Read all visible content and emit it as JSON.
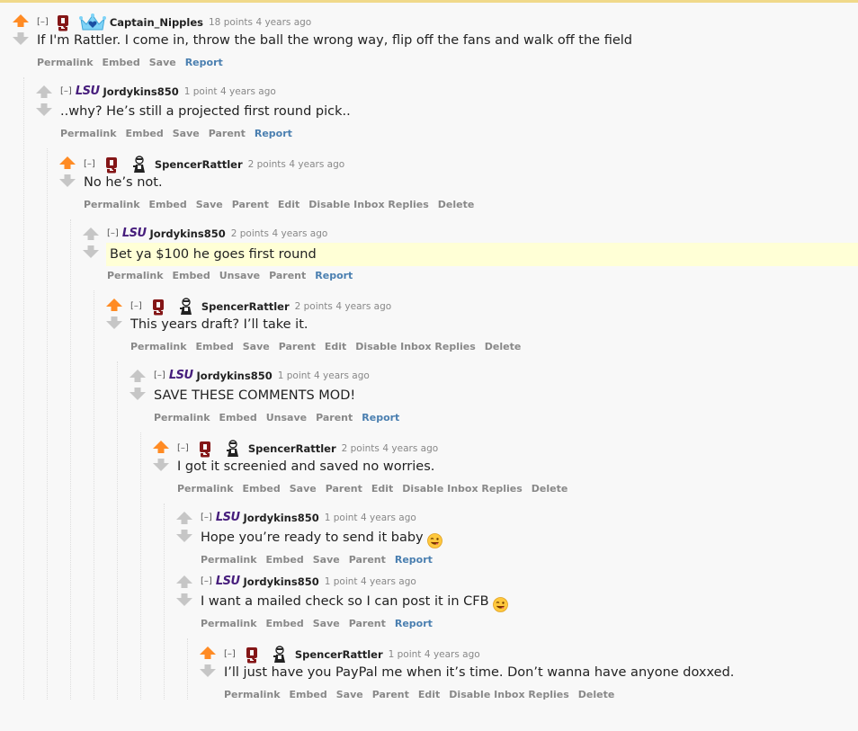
{
  "comments": [
    {
      "id": "c0",
      "depth": 0,
      "upvoted": true,
      "flair": "ou-crown",
      "expand": "[–]",
      "author": "Captain_Nipples",
      "score": "18 points",
      "time": "4 years ago",
      "body": "If I'm Rattler. I come in, throw the ball the wrong way, flip off the fans and walk off the field",
      "buttons": [
        "Permalink",
        "Embed",
        "Save",
        "Report"
      ]
    },
    {
      "id": "c1",
      "depth": 1,
      "upvoted": false,
      "flair": "lsu",
      "expand": "[–]",
      "author": "Jordykins850",
      "score": "1 point",
      "time": "4 years ago",
      "body": "..why? He’s still a projected first round pick..",
      "buttons": [
        "Permalink",
        "Embed",
        "Save",
        "Parent",
        "Report"
      ]
    },
    {
      "id": "c2",
      "depth": 2,
      "upvoted": true,
      "flair": "ou-avatar",
      "expand": "[–]",
      "author": "SpencerRattler",
      "score": "2 points",
      "time": "4 years ago",
      "body": "No he’s not.",
      "buttons": [
        "Permalink",
        "Embed",
        "Save",
        "Parent",
        "Edit",
        "Disable Inbox Replies",
        "Delete"
      ]
    },
    {
      "id": "c3",
      "depth": 3,
      "upvoted": false,
      "flair": "lsu",
      "highlight": true,
      "expand": "[–]",
      "author": "Jordykins850",
      "score": "2 points",
      "time": "4 years ago",
      "body": "Bet ya $100 he goes first round",
      "buttons": [
        "Permalink",
        "Embed",
        "Unsave",
        "Parent",
        "Report"
      ]
    },
    {
      "id": "c4",
      "depth": 4,
      "upvoted": true,
      "flair": "ou-avatar",
      "expand": "[–]",
      "author": "SpencerRattler",
      "score": "2 points",
      "time": "4 years ago",
      "body": "This years draft? I’ll take it.",
      "buttons": [
        "Permalink",
        "Embed",
        "Save",
        "Parent",
        "Edit",
        "Disable Inbox Replies",
        "Delete"
      ]
    },
    {
      "id": "c5",
      "depth": 5,
      "upvoted": false,
      "flair": "lsu",
      "expand": "[–]",
      "author": "Jordykins850",
      "score": "1 point",
      "time": "4 years ago",
      "body": "SAVE THESE COMMENTS MOD!",
      "buttons": [
        "Permalink",
        "Embed",
        "Unsave",
        "Parent",
        "Report"
      ]
    },
    {
      "id": "c6",
      "depth": 6,
      "upvoted": true,
      "flair": "ou-avatar",
      "expand": "[–]",
      "author": "SpencerRattler",
      "score": "2 points",
      "time": "4 years ago",
      "body": "I got it screenied and saved no worries.",
      "buttons": [
        "Permalink",
        "Embed",
        "Save",
        "Parent",
        "Edit",
        "Disable Inbox Replies",
        "Delete"
      ]
    },
    {
      "id": "c7",
      "depth": 7,
      "upvoted": false,
      "flair": "lsu",
      "expand": "[–]",
      "author": "Jordykins850",
      "score": "1 point",
      "time": "4 years ago",
      "body": "Hope you’re ready to send it baby",
      "emoji": "wink-tongue-emoji",
      "buttons": [
        "Permalink",
        "Embed",
        "Save",
        "Parent",
        "Report"
      ]
    },
    {
      "id": "c8",
      "depth": 7,
      "upvoted": false,
      "flair": "lsu",
      "expand": "[–]",
      "author": "Jordykins850",
      "score": "1 point",
      "time": "4 years ago",
      "body": "I want a mailed check so I can post it in CFB",
      "emoji": "wink-tongue-emoji",
      "buttons": [
        "Permalink",
        "Embed",
        "Save",
        "Parent",
        "Report"
      ]
    },
    {
      "id": "c9",
      "depth": 8,
      "upvoted": true,
      "flair": "ou-avatar",
      "expand": "[–]",
      "author": "SpencerRattler",
      "score": "1 point",
      "time": "4 years ago",
      "body": "I’ll just have you PayPal me when it’s time. Don’t wanna have anyone doxxed.",
      "buttons": [
        "Permalink",
        "Embed",
        "Save",
        "Parent",
        "Edit",
        "Disable Inbox Replies",
        "Delete"
      ]
    }
  ],
  "flair_text": {
    "lsu": "LSU"
  },
  "colors": {
    "upvote": "#ff8b24",
    "neutral": "#c6c6c6",
    "report": "#4a7fb0",
    "ou": "#841617",
    "lsu": "#461d7c",
    "highlight": "#ffffd6"
  }
}
